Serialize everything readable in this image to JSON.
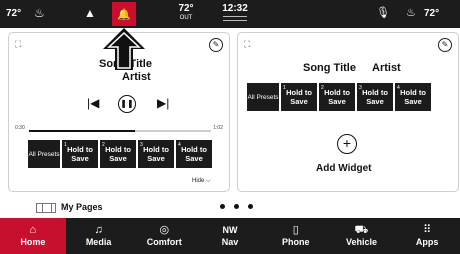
{
  "status": {
    "left_temp": "72°",
    "outside_temp": "72°",
    "outside_label": "OUT",
    "time": "12:32",
    "right_temp": "72°"
  },
  "left_widget": {
    "song_title": "Song Title",
    "artist": "Artist",
    "time_start": "0:30",
    "time_end": "1:02",
    "progress": 0.58,
    "all_presets": "All Presets",
    "presets": [
      {
        "num": "1",
        "label": "Hold to Save"
      },
      {
        "num": "2",
        "label": "Hold to Save"
      },
      {
        "num": "3",
        "label": "Hold to Save"
      },
      {
        "num": "4",
        "label": "Hold to Save"
      }
    ],
    "hide_label": "Hide"
  },
  "right_widget": {
    "song_title": "Song Title",
    "artist": "Artist",
    "all_presets": "All Presets",
    "presets": [
      {
        "num": "1",
        "label": "Hold to Save"
      },
      {
        "num": "2",
        "label": "Hold to Save"
      },
      {
        "num": "3",
        "label": "Hold to Save"
      },
      {
        "num": "4",
        "label": "Hold to Save"
      }
    ],
    "add_widget": "Add Widget"
  },
  "pages": {
    "label": "My Pages"
  },
  "nav": {
    "home": "Home",
    "media": "Media",
    "comfort": "Comfort",
    "nav_dir": "NW",
    "nav": "Nav",
    "phone": "Phone",
    "vehicle": "Vehicle",
    "apps": "Apps"
  },
  "colors": {
    "accent": "#c8102e",
    "bar": "#1c1c1c"
  }
}
